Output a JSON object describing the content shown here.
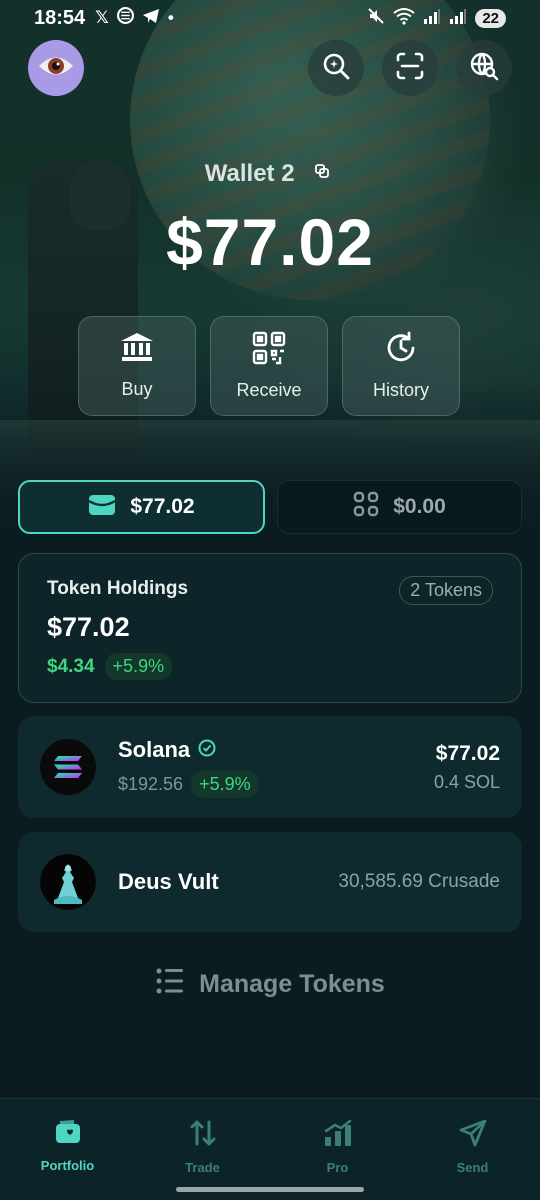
{
  "status_bar": {
    "time": "18:54",
    "battery": "22",
    "left_icons": [
      "x-icon",
      "beeper-icon",
      "telegram-icon",
      "dot-icon"
    ],
    "right_icons": [
      "mute-icon",
      "wifi-icon",
      "signal-icon",
      "signal-icon"
    ]
  },
  "header": {
    "avatar_icon": "eye-icon",
    "buttons": [
      "search-icon",
      "scan-icon",
      "globe-search-icon"
    ]
  },
  "wallet": {
    "name": "Wallet 2",
    "balance": "$77.02"
  },
  "actions": [
    {
      "label": "Buy",
      "icon": "bank-icon"
    },
    {
      "label": "Receive",
      "icon": "qr-code-icon"
    },
    {
      "label": "History",
      "icon": "history-icon"
    }
  ],
  "segments": {
    "tokens_value": "$77.02",
    "collectibles_value": "$0.00"
  },
  "holdings": {
    "title": "Token Holdings",
    "count": "2 Tokens",
    "value": "$77.02",
    "change_abs": "$4.34",
    "change_pct": "+5.9%"
  },
  "tokens": [
    {
      "name": "Solana",
      "verified": true,
      "price": "$192.56",
      "change": "+5.9%",
      "usd_value": "$77.02",
      "amount": "0.4 SOL"
    },
    {
      "name": "Deus Vult",
      "amount": "30,585.69 Crusade"
    }
  ],
  "manage_tokens": "Manage Tokens",
  "nav": [
    {
      "label": "Portfolio",
      "icon": "wallet-icon",
      "active": true
    },
    {
      "label": "Trade",
      "icon": "swap-arrows-icon",
      "active": false
    },
    {
      "label": "Pro",
      "icon": "chart-icon",
      "active": false
    },
    {
      "label": "Send",
      "icon": "send-icon",
      "active": false
    }
  ],
  "colors": {
    "accent": "#4fd6c2",
    "positive": "#3ed67e",
    "background": "#0a1c20",
    "avatar": "#a99ae8"
  }
}
